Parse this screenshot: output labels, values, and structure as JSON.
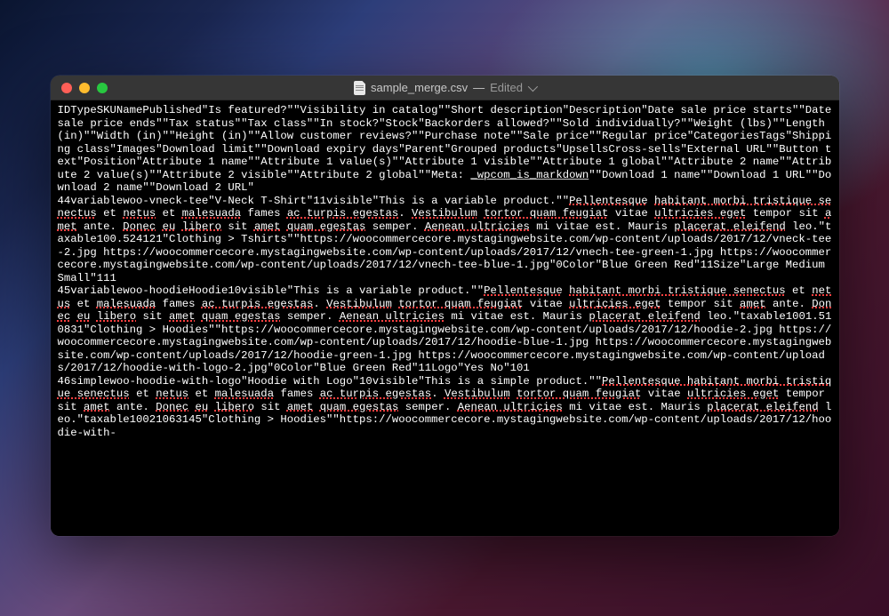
{
  "titlebar": {
    "filename": "sample_merge.csv",
    "status": "Edited"
  },
  "content": {
    "header": "IDTypeSKUNamePublished\"Is featured?\"\"Visibility in catalog\"\"Short description\"Description\"Date sale price starts\"\"Date sale price ends\"\"Tax status\"\"Tax class\"\"In stock?\"Stock\"Backorders allowed?\"\"Sold individually?\"\"Weight (lbs)\"\"Length (in)\"\"Width (in)\"\"Height (in)\"\"Allow customer reviews?\"\"Purchase note\"\"Sale price\"\"Regular price\"CategoriesTags\"Shipping class\"Images\"Download limit\"\"Download expiry days\"Parent\"Grouped products\"UpsellsCross-sells\"External URL\"\"Button text\"Position\"Attribute 1 name\"\"Attribute 1 value(s)\"\"Attribute 1 visible\"\"Attribute 1 global\"\"Attribute 2 name\"\"Attribute 2 value(s)\"\"Attribute 2 visible\"\"Attribute 2 global\"\"Meta: ",
    "header_meta": "_wpcom_is_markdown",
    "header_tail": "\"\"Download 1 name\"\"Download 1 URL\"\"Download 2 name\"\"Download 2 URL\"",
    "row1_a": "44variablewoo-vneck-tee\"V-Neck T-Shirt\"11visible\"This is a variable product.\"\"",
    "row1_b": "Pellentesque",
    "row1_c": " ",
    "row1_d": "habitant morbi tristique senectus",
    "row1_e": " et ",
    "row1_f": "netus",
    "row1_g": " et ",
    "row1_h": "malesuada",
    "row1_i": " fames ",
    "row1_j": "ac turpis egestas",
    "row1_k": ". ",
    "row1_l": "Vestibulum",
    "row1_m": " ",
    "row1_n": "tortor quam feugiat",
    "row1_o": " vitae ",
    "row1_p": "ultricies eget",
    "row1_q": " tempor sit ",
    "row1_r": "amet",
    "row1_s": " ante. ",
    "row1_t": "Donec",
    "row1_u": " ",
    "row1_v": "eu",
    "row1_w": " ",
    "row1_x": "libero",
    "row1_y": " sit ",
    "row1_z": "amet",
    "row1_aa": " ",
    "row1_ab": "quam egestas",
    "row1_ac": " semper. ",
    "row1_ad": "Aenean ultricies",
    "row1_ae": " mi vitae est. Mauris ",
    "row1_af": "placerat eleifend",
    "row1_ag": " leo.\"taxable100.524121\"Clothing > Tshirts\"\"https://woocommercecore.mystagingwebsite.com/wp-content/uploads/2017/12/vneck-tee-2.jpg https://woocommercecore.mystagingwebsite.com/wp-content/uploads/2017/12/vnech-tee-green-1.jpg https://woocommercecore.mystagingwebsite.com/wp-content/uploads/2017/12/vnech-tee-blue-1.jpg\"0Color\"Blue Green Red\"11Size\"Large Medium Small\"111",
    "row2_a": "45variablewoo-hoodieHoodie10visible\"This is a variable product.\"\"",
    "row2_b": "Pellentesque",
    "row2_c": " ",
    "row2_d": "habitant morbi tristique senectus",
    "row2_e": " et ",
    "row2_f": "netus",
    "row2_g": " et ",
    "row2_h": "malesuada",
    "row2_i": " fames ",
    "row2_j": "ac turpis egestas",
    "row2_k": ". ",
    "row2_l": "Vestibulum",
    "row2_m": " ",
    "row2_n": "tortor quam feugiat",
    "row2_o": " vitae ",
    "row2_p": "ultricies eget",
    "row2_q": " tempor sit ",
    "row2_r": "amet",
    "row2_s": " ante. ",
    "row2_t": "Donec",
    "row2_u": " ",
    "row2_v": "eu",
    "row2_w": " ",
    "row2_x": "libero",
    "row2_y": " sit ",
    "row2_z": "amet",
    "row2_aa": " ",
    "row2_ab": "quam egestas",
    "row2_ac": " semper. ",
    "row2_ad": "Aenean ultricies",
    "row2_ae": " mi vitae est. Mauris ",
    "row2_af": "placerat eleifend",
    "row2_ag": " leo.\"taxable1001.510831\"Clothing > Hoodies\"\"https://woocommercecore.mystagingwebsite.com/wp-content/uploads/2017/12/hoodie-2.jpg https://woocommercecore.mystagingwebsite.com/wp-content/uploads/2017/12/hoodie-blue-1.jpg https://woocommercecore.mystagingwebsite.com/wp-content/uploads/2017/12/hoodie-green-1.jpg https://woocommercecore.mystagingwebsite.com/wp-content/uploads/2017/12/hoodie-with-logo-2.jpg\"0Color\"Blue Green Red\"11Logo\"Yes No\"101",
    "row3_a": "46simplewoo-hoodie-with-logo\"Hoodie with Logo\"10visible\"This is a simple product.\"\"",
    "row3_b": "Pellentesque habitant morbi tristique senectus",
    "row3_c": " et ",
    "row3_d": "netus",
    "row3_e": " et ",
    "row3_f": "malesuada",
    "row3_g": " fames ",
    "row3_h": "ac turpis egestas",
    "row3_i": ". ",
    "row3_j": "Vestibulum",
    "row3_k": " ",
    "row3_l": "tortor quam feugiat",
    "row3_m": " vitae ",
    "row3_n": "ultricies eget",
    "row3_o": " tempor sit ",
    "row3_p": "amet",
    "row3_q": " ante. ",
    "row3_r": "Donec",
    "row3_s": " ",
    "row3_t": "eu",
    "row3_u": " ",
    "row3_v": "libero",
    "row3_w": " sit ",
    "row3_x": "amet",
    "row3_y": " ",
    "row3_z": "quam egestas",
    "row3_aa": " semper. ",
    "row3_ab": "Aenean ultricies",
    "row3_ac": " mi vitae est. Mauris ",
    "row3_ad": "placerat eleifend",
    "row3_ae": " leo.\"taxable10021063145\"Clothing > Hoodies\"\"https://woocommercecore.mystagingwebsite.com/wp-content/uploads/2017/12/hoodie-with-"
  }
}
